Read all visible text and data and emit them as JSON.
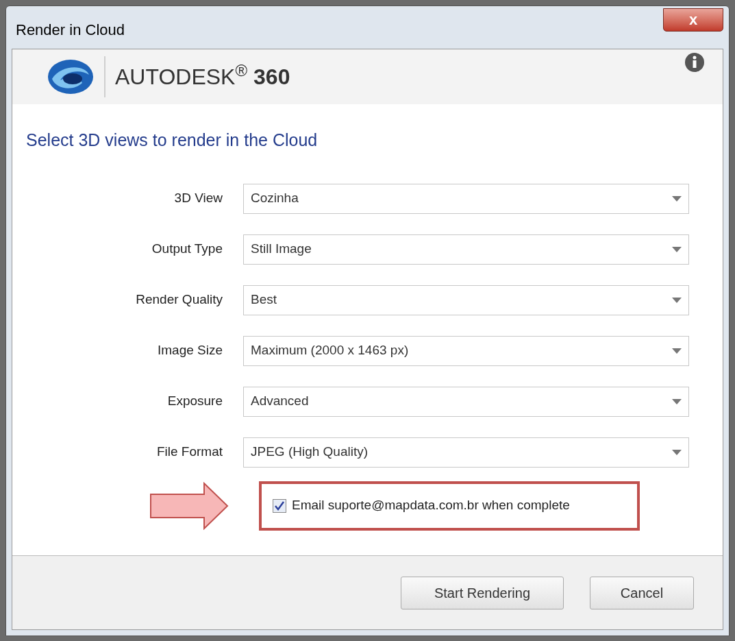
{
  "window": {
    "title": "Render in Cloud",
    "close_label": "x"
  },
  "header": {
    "brand": "AUTODESK$^{®}$ **360**"
  },
  "heading": "Select 3D views to render in the Cloud",
  "fields": [
    {
      "label": "3D View",
      "value": "Cozinha"
    },
    {
      "label": "Output Type",
      "value": "Still Image"
    },
    {
      "label": "Render Quality",
      "value": "Best"
    },
    {
      "label": "Image Size",
      "value": "Maximum (2000 x 1463 px)"
    },
    {
      "label": "Exposure",
      "value": "Advanced"
    },
    {
      "label": "File Format",
      "value": "JPEG (High Quality)"
    }
  ],
  "email_option": {
    "label": "Email suporte@mapdata.com.br when complete",
    "checked": true,
    "highlighted": true
  },
  "buttons": [
    {
      "label": "Start Rendering"
    },
    {
      "label": "Cancel"
    }
  ]
}
